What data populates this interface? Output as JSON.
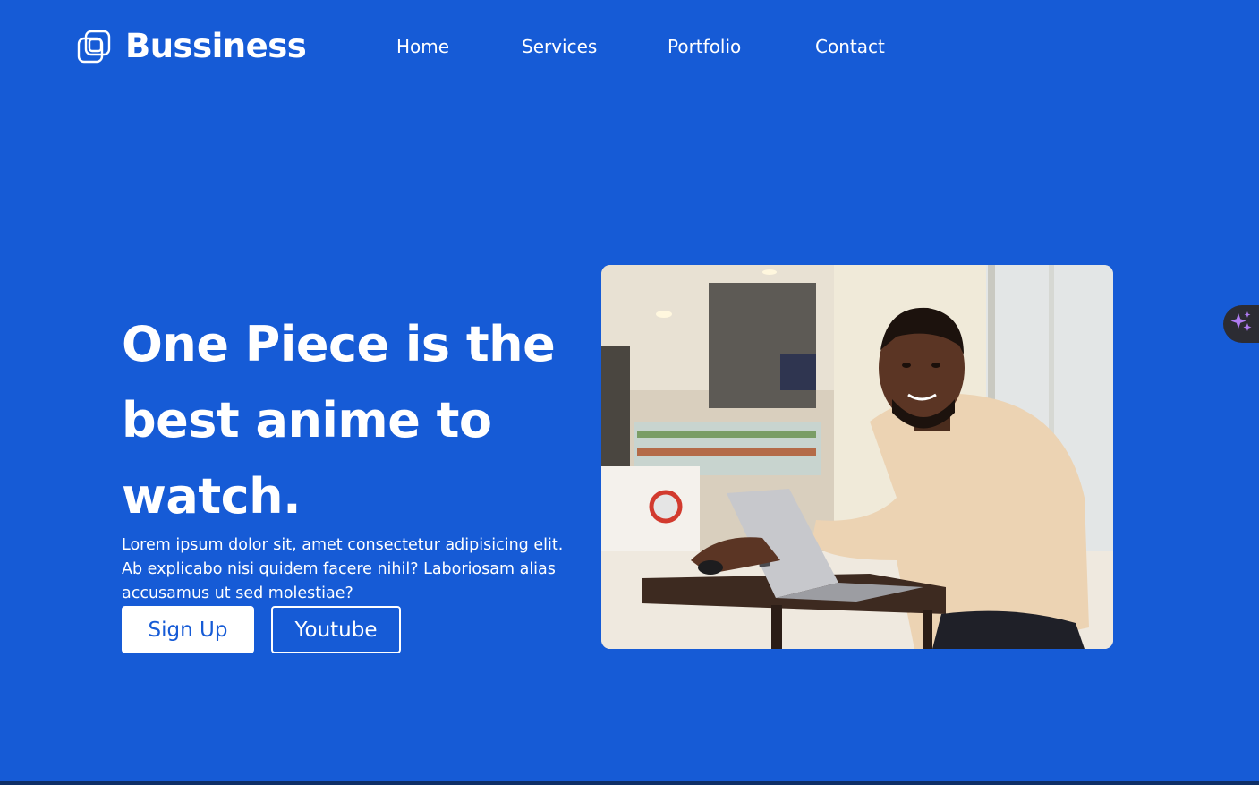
{
  "brand": {
    "name": "Bussiness",
    "icon": "squares-logo-icon"
  },
  "nav": {
    "items": [
      {
        "label": "Home"
      },
      {
        "label": "Services"
      },
      {
        "label": "Portfolio"
      },
      {
        "label": "Contact"
      }
    ]
  },
  "hero": {
    "title": "One Piece is the best anime to watch.",
    "description": "Lorem ipsum dolor sit, amet consectetur adipisicing elit. Ab explicabo nisi quidem facere nihil? Laboriosam alias accusamus ut sed molestiae?",
    "primary_button": "Sign Up",
    "secondary_button": "Youtube",
    "image_subject": "man smiling while using a laptop at a cafe table"
  },
  "assistant": {
    "icon": "sparkle-icon"
  },
  "colors": {
    "background": "#165bd6",
    "text": "#ffffff",
    "primary_button_bg": "#ffffff",
    "primary_button_text": "#165bd6",
    "assistant_bg": "#2c2c33",
    "sparkle": "#b07cf2"
  }
}
